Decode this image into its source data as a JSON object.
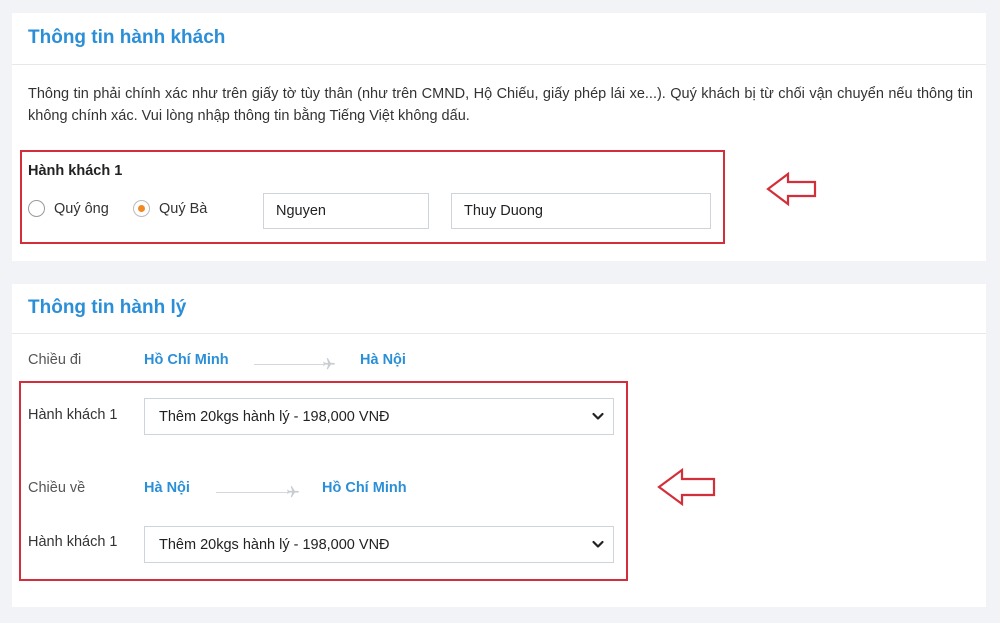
{
  "passenger_section": {
    "title": "Thông tin hành khách",
    "notice": "Thông tin phải chính xác như trên giấy tờ tùy thân (như trên CMND, Hộ Chiếu, giấy phép lái xe...). Quý khách bị từ chối vận chuyển nếu thông tin không chính xác. Vui lòng nhập thông tin bằng Tiếng Việt không dấu.",
    "passenger_label": "Hành khách 1",
    "title_options": [
      {
        "label": "Quý ông",
        "checked": false
      },
      {
        "label": "Quý Bà",
        "checked": true
      }
    ],
    "last_name": "Nguyen",
    "first_name": "Thuy Duong"
  },
  "baggage_section": {
    "title": "Thông tin hành lý",
    "departure": {
      "label": "Chiều đi",
      "from": "Hồ Chí Minh",
      "to": "Hà Nội",
      "passenger_label": "Hành khách 1",
      "selected_option": "Thêm 20kgs hành lý - 198,000 VNĐ"
    },
    "return": {
      "label": "Chiều về",
      "from": "Hà Nội",
      "to": "Hồ Chí Minh",
      "passenger_label": "Hành khách 1",
      "selected_option": "Thêm 20kgs hành lý - 198,000 VNĐ"
    }
  },
  "colors": {
    "accent": "#2b8fd8",
    "highlight_border": "#d32f3a",
    "radio_selected": "#f08a24",
    "page_background": "#f1f3f6"
  },
  "icons": {
    "route_separator": "airplane-icon",
    "select_caret": "chevron-down-icon",
    "annotation": "left-arrow-icon"
  }
}
